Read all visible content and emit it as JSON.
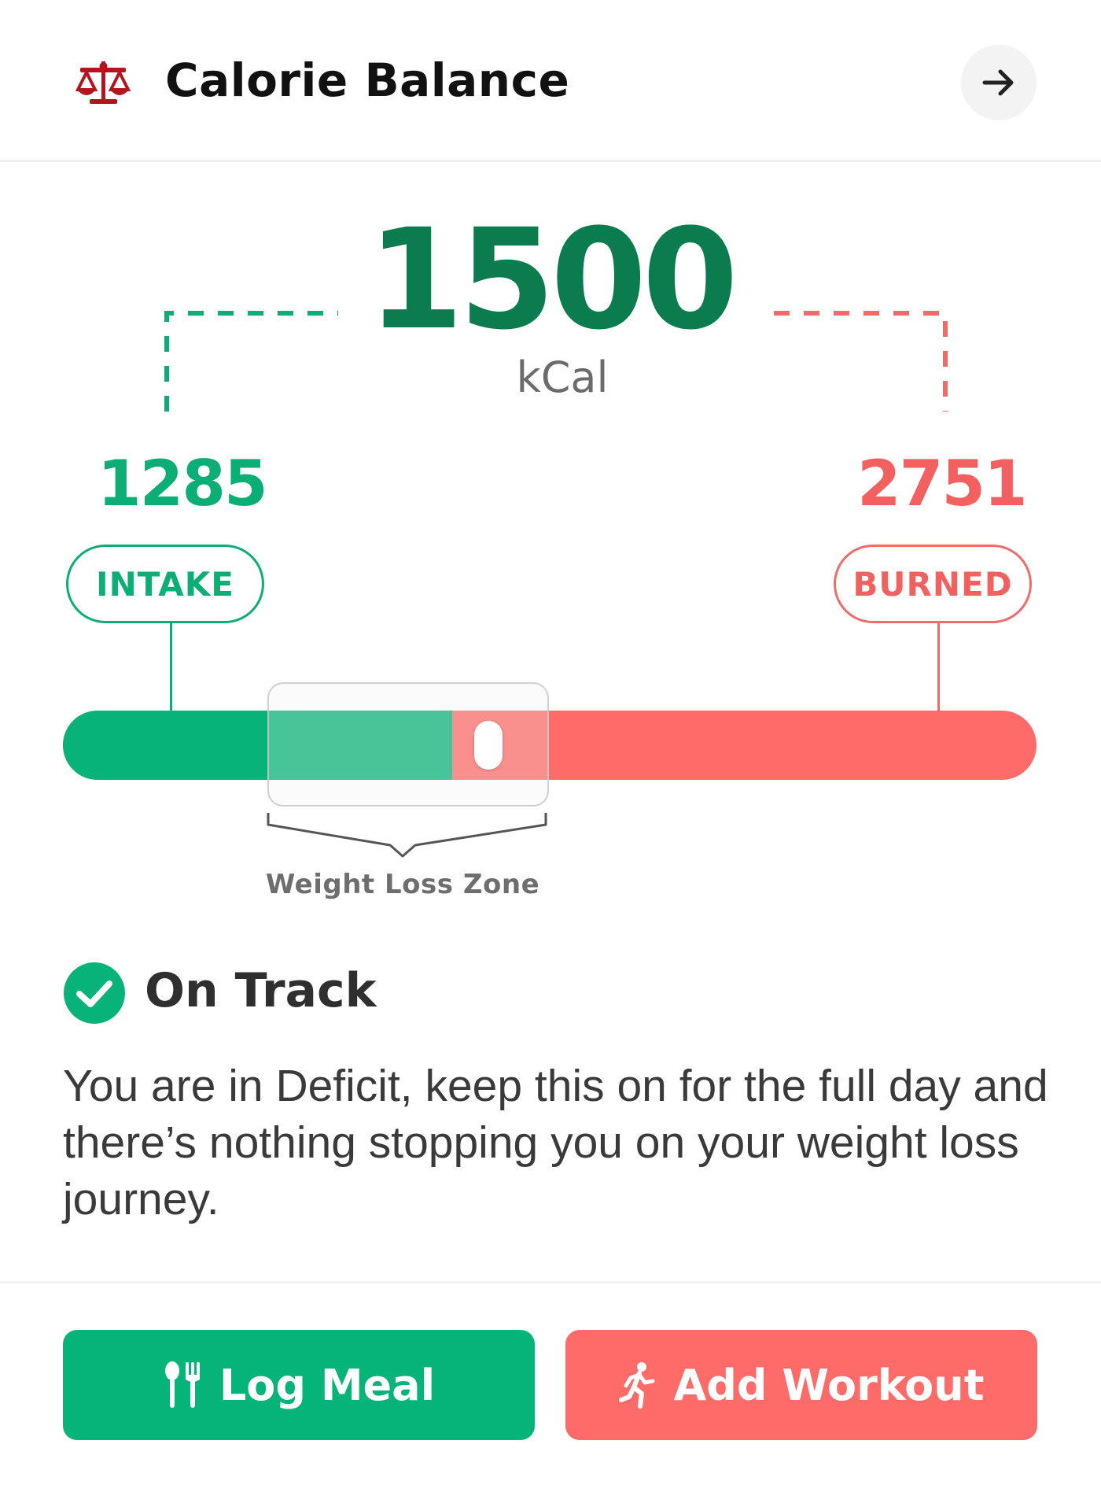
{
  "header": {
    "title": "Calorie Balance",
    "icon": "scale-icon",
    "action_icon": "arrow-right-icon",
    "accent": "#b3151c"
  },
  "balance": {
    "value": "1500",
    "unit": "kCal",
    "color": "#0a7c4e"
  },
  "intake": {
    "value": "1285",
    "label": "INTAKE",
    "color": "#0bae75"
  },
  "burned": {
    "value": "2751",
    "label": "BURNED",
    "color": "#f2605f"
  },
  "bar": {
    "intake_fraction": 0.4,
    "zone_label": "Weight Loss Zone"
  },
  "status": {
    "icon": "check-circle-icon",
    "title": "On Track",
    "message": "You are in Deficit, keep this on for the full day and there’s nothing stopping you on your weight loss journey."
  },
  "actions": {
    "log_meal_label": "Log Meal",
    "log_meal_icon": "fork-knife-icon",
    "add_workout_label": "Add Workout",
    "add_workout_icon": "running-icon"
  }
}
